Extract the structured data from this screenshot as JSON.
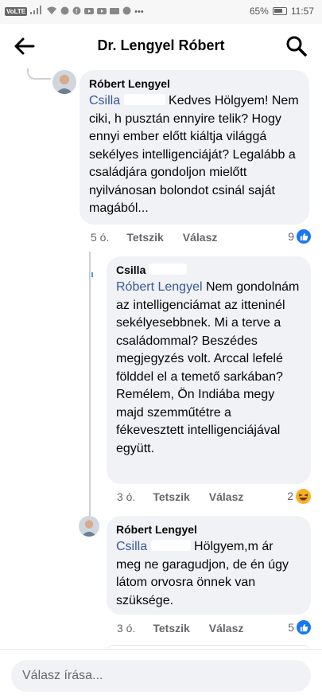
{
  "status_bar": {
    "carrier_badge": "VoLTE",
    "battery": "65%",
    "time": "11:57"
  },
  "header": {
    "title": "Dr. Lengyel Róbert"
  },
  "comments": [
    {
      "author": "Róbert Lengyel",
      "mention": "Csilla",
      "text": "Kedves Hölgyem! Nem ciki, h pusztán ennyire telik? Hogy ennyi ember előtt kiáltja világgá sekélyes intelligenciáját? Legalább a családjára gondoljon mielőtt nyilvánosan bolondot csinál saját magából...",
      "time": "5 ó.",
      "like_label": "Tetszik",
      "reply_label": "Válasz",
      "reaction_count": "9",
      "reaction": "like-icon"
    },
    {
      "author": "Csilla",
      "mention": "Róbert Lengyel",
      "text": "Nem gondolnám az intelligenciámat az itteninél sekélyesebbnek. Mi a terve a családommal? Beszédes megjegyzés volt. Arccal lefelé földdel el a temető sarkában? Remélem, Ön Indiába megy majd szemműtétre a fékevesztett intelligenciájával együtt.",
      "time": "3 ó.",
      "like_label": "Tetszik",
      "reply_label": "Válasz",
      "reaction_count": "2",
      "reaction": "haha-icon"
    },
    {
      "author": "Róbert Lengyel",
      "mention": "Csilla",
      "text": "Hölgyem,m ár meg ne garagudjon, de én úgy látom orvosra önnek van szüksége.",
      "time": "3 ó.",
      "like_label": "Tetszik",
      "reply_label": "Válasz",
      "reaction_count": "5",
      "reaction": "like-icon"
    }
  ],
  "reply_bar": {
    "placeholder": "Válasz írása..."
  },
  "colors": {
    "accent": "#1877f2",
    "mention": "#385898",
    "bubble": "#f0f2f5",
    "muted": "#65676b"
  }
}
